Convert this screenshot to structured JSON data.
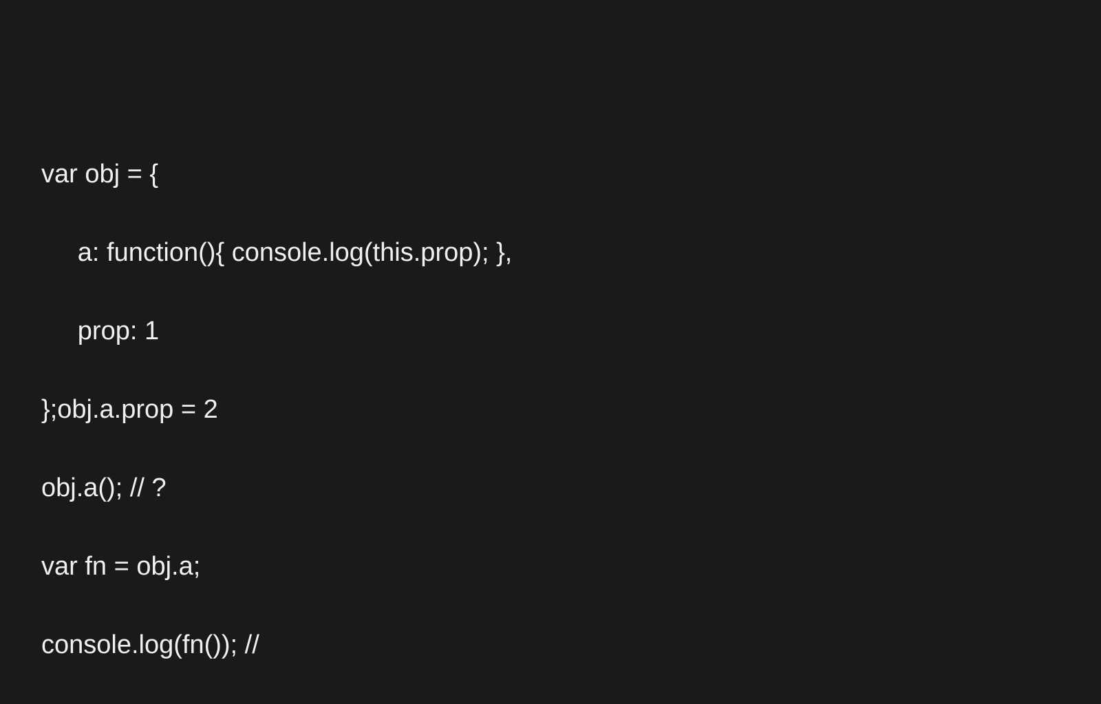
{
  "code": {
    "lines": [
      "var obj = {",
      "     a: function(){ console.log(this.prop); },",
      "     prop: 1",
      "};obj.a.prop = 2",
      "obj.a(); // ?",
      "var fn = obj.a;",
      "console.log(fn()); //"
    ]
  }
}
